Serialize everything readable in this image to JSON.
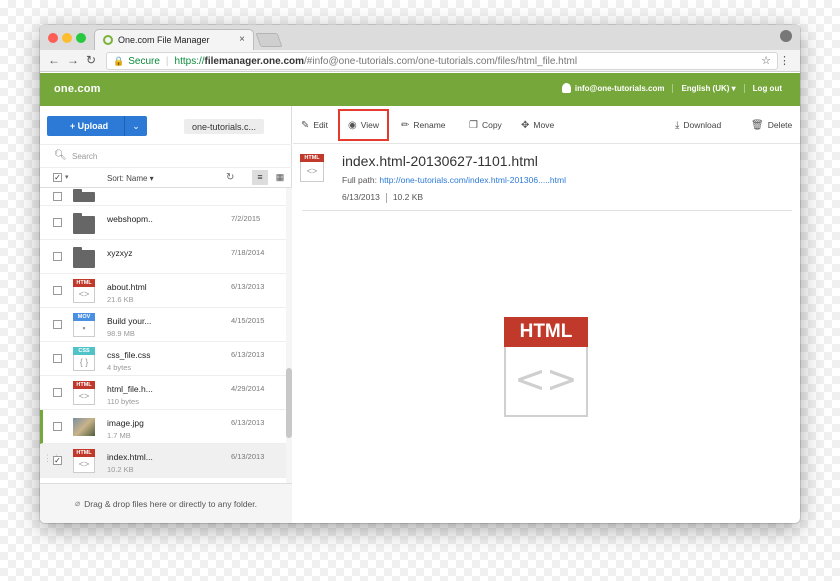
{
  "browser": {
    "tab_title": "One.com File Manager",
    "tab_close": "×",
    "secure_label": "Secure",
    "url_prefix": "https://",
    "url_domain": "filemanager.one.com",
    "url_rest": "/#info@one-tutorials.com/one-tutorials.com/files/html_file.html"
  },
  "header": {
    "logo": "one.com",
    "user_email": "info@one-tutorials.com",
    "language": "English (UK) ▾",
    "logout": "Log out"
  },
  "left": {
    "upload_label": "+ Upload",
    "upload_caret": "⌄",
    "breadcrumb": "one-tutorials.c...",
    "search_placeholder": "Search",
    "sort_label": "Sort: Name ▾",
    "dropzone_text": "Drag & drop files here or directly to any folder."
  },
  "files": [
    {
      "name": "",
      "size": "",
      "date": "",
      "type": "folder"
    },
    {
      "name": "webshopm..",
      "size": "",
      "date": "7/2/2015",
      "type": "folder"
    },
    {
      "name": "xyzxyz",
      "size": "",
      "date": "7/18/2014",
      "type": "folder"
    },
    {
      "name": "about.html",
      "size": "21.6 KB",
      "date": "6/13/2013",
      "type": "html",
      "badge": "HTML",
      "badge_color": "#c0392b"
    },
    {
      "name": "Build your...",
      "size": "98.9 MB",
      "date": "4/15/2015",
      "type": "mov",
      "badge": "MOV",
      "badge_color": "#4a90e2"
    },
    {
      "name": "css_file.css",
      "size": "4 bytes",
      "date": "6/13/2013",
      "type": "css",
      "badge": "CSS",
      "badge_color": "#4fc3c7"
    },
    {
      "name": "html_file.h...",
      "size": "110 bytes",
      "date": "4/29/2014",
      "type": "html",
      "badge": "HTML",
      "badge_color": "#c0392b"
    },
    {
      "name": "image.jpg",
      "size": "1.7 MB",
      "date": "6/13/2013",
      "type": "image"
    },
    {
      "name": "index.html...",
      "size": "10.2 KB",
      "date": "6/13/2013",
      "type": "html",
      "badge": "HTML",
      "badge_color": "#c0392b"
    }
  ],
  "toolbar": {
    "edit": "Edit",
    "view": "View",
    "rename": "Rename",
    "copy": "Copy",
    "move": "Move",
    "download": "Download",
    "delete": "Delete"
  },
  "detail": {
    "badge": "HTML",
    "title": "index.html-20130627-1101.html",
    "path_label": "Full path:",
    "path_link": "http://one-tutorials.com/index.html-201306.....html",
    "date": "6/13/2013",
    "size": "10.2 KB",
    "glyph": "<>"
  },
  "colors": {
    "brand_green": "#76a73b",
    "upload_blue": "#2d7ad6",
    "highlight_red": "#e53b2f",
    "html_red": "#c0392b"
  }
}
